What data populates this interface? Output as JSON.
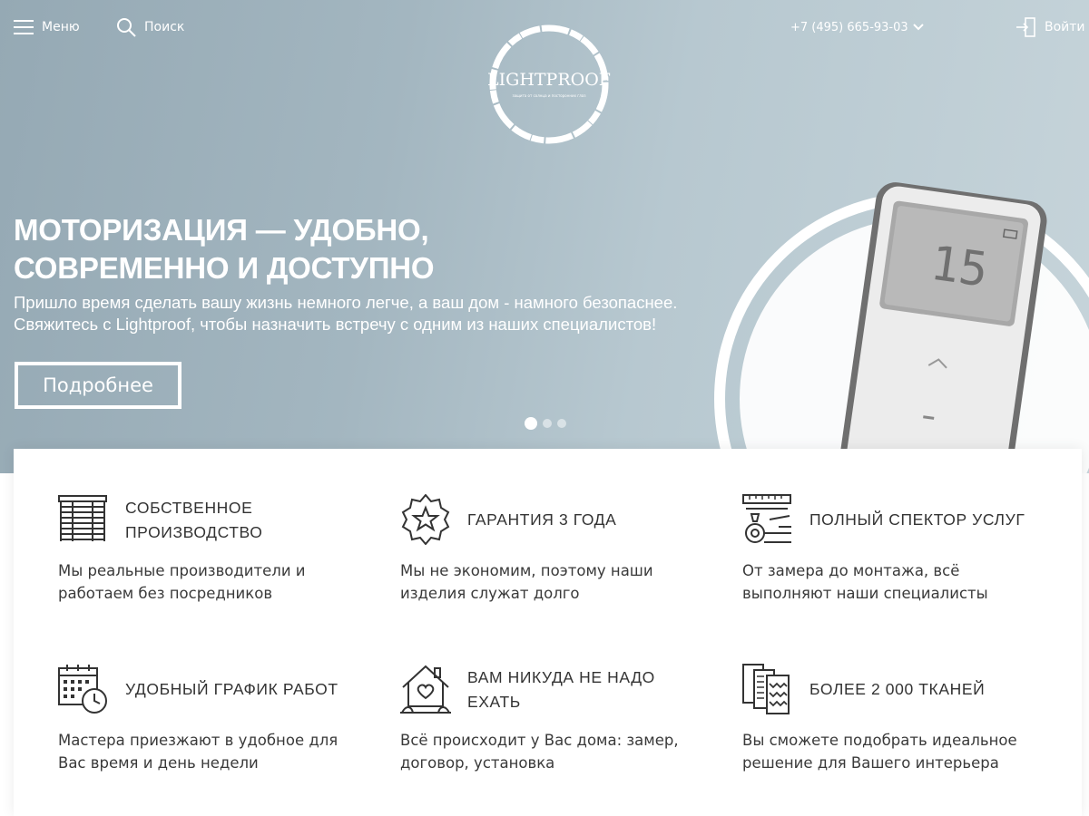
{
  "nav": {
    "menu_label": "Меню",
    "search_label": "Поиск",
    "phone": "+7 (495) 665-93-03",
    "login_label": "Войти"
  },
  "logo": {
    "name": "LIGHTPROOF",
    "tagline": "защита от солнца и посторонних глаз"
  },
  "slider": {
    "title_line1": "МОТОРИЗАЦИЯ — УДОБНО,",
    "title_line2": "СОВРЕМЕННО И ДОСТУПНО",
    "text_line1": "Пришло время сделать вашу жизнь немного легче, а ваш дом - намного безопаснее.",
    "text_line2": "Свяжитесь с Lightproof, чтобы назначить встречу с одним из наших специалистов!",
    "button_label": "Подробнее",
    "slide_count": 3,
    "active_slide": 1,
    "remote_display": "15"
  },
  "features": [
    {
      "icon": "blinds-icon",
      "title_line1": "СОБСТВЕННОЕ",
      "title_line2": "ПРОИЗВОДСТВО",
      "desc_line1": "Мы реальные производители и",
      "desc_line2": "работаем без посредников"
    },
    {
      "icon": "star-badge-icon",
      "title_line1": "ГАРАНТИЯ 3 ГОДА",
      "title_line2": "",
      "desc_line1": "Мы не экономим, поэтому наши",
      "desc_line2": "изделия служат долго"
    },
    {
      "icon": "tools-icon",
      "title_line1": "ПОЛНЫЙ СПЕКТОР УСЛУГ",
      "title_line2": "",
      "desc_line1": "От замера до монтажа, всё",
      "desc_line2": "выполняют наши специалисты"
    },
    {
      "icon": "calendar-clock-icon",
      "title_line1": "УДОБНЫЙ ГРАФИК РАБОТ",
      "title_line2": "",
      "desc_line1": "Мастера приезжают в удобное для",
      "desc_line2": "Вас время и день недели"
    },
    {
      "icon": "house-heart-icon",
      "title_line1": "ВАМ НИКУДА НЕ НАДО",
      "title_line2": "ЕХАТЬ",
      "desc_line1": "Всё происходит у Вас дома: замер,",
      "desc_line2": "договор, установка"
    },
    {
      "icon": "fabric-samples-icon",
      "title_line1": "БОЛЕЕ 2 000 ТКАНЕЙ",
      "title_line2": "",
      "desc_line1": "Вы сможете подобрать идеальное",
      "desc_line2": "решение для Вашего интерьера"
    }
  ]
}
